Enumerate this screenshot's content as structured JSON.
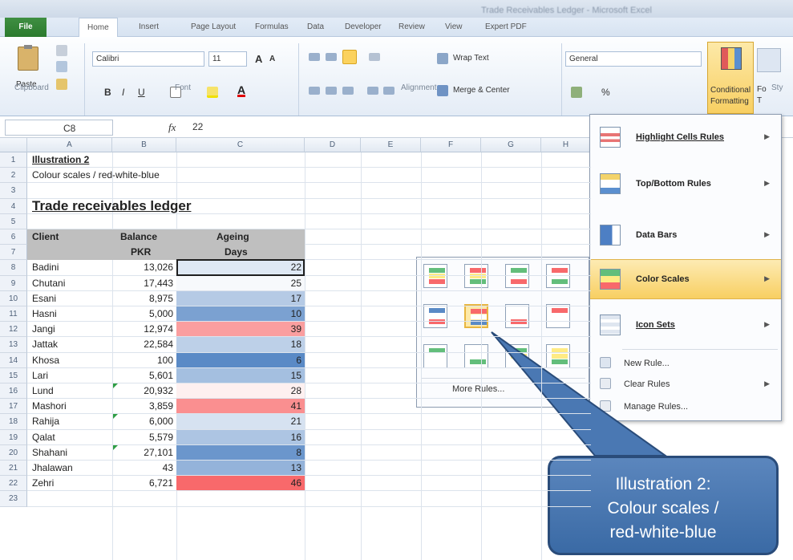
{
  "window": {
    "title": "Trade Receivables Ledger - Microsoft Excel"
  },
  "tabs": [
    "File",
    "Home",
    "Insert",
    "Page Layout",
    "Formulas",
    "Data",
    "Developer",
    "Review",
    "View",
    "Expert PDF"
  ],
  "ribbon": {
    "clipboard": {
      "paste": "Paste",
      "group": "Clipboard"
    },
    "font": {
      "name": "Calibri",
      "size": "11",
      "group": "Font",
      "bold": "B",
      "italic": "I",
      "underline": "U",
      "grow": "A",
      "shrink": "A"
    },
    "alignment": {
      "wrap": "Wrap Text",
      "merge": "Merge & Center",
      "group": "Alignment"
    },
    "number": {
      "format": "General",
      "percent": "%",
      "comma": ",",
      "inc": ".0",
      ".dec": ".00"
    },
    "styles": {
      "conditional": "Conditional",
      "formatting": "Formatting",
      "format_as": "Fo",
      "table": "T",
      "group": "Sty"
    }
  },
  "formula_bar": {
    "name_box": "C8",
    "fx": "fx",
    "value": "22"
  },
  "columns": [
    "A",
    "B",
    "C",
    "D",
    "E",
    "F",
    "G",
    "H"
  ],
  "sheet": {
    "a1": "Illustration 2",
    "a2": "Colour scales / red-white-blue",
    "a4": "Trade receivables ledger",
    "headers": {
      "client": "Client",
      "balance": "Balance",
      "pkr": "PKR",
      "ageing": "Ageing",
      "days": "Days"
    },
    "rows": [
      {
        "client": "Badini",
        "balance": "13,026",
        "days": "22"
      },
      {
        "client": "Chutani",
        "balance": "17,443",
        "days": "25"
      },
      {
        "client": "Esani",
        "balance": "8,975",
        "days": "17"
      },
      {
        "client": "Hasni",
        "balance": "5,000",
        "days": "10"
      },
      {
        "client": "Jangi",
        "balance": "12,974",
        "days": "39"
      },
      {
        "client": "Jattak",
        "balance": "22,584",
        "days": "18"
      },
      {
        "client": "Khosa",
        "balance": "100",
        "days": "6"
      },
      {
        "client": "Lari",
        "balance": "5,601",
        "days": "15"
      },
      {
        "client": "Lund",
        "balance": "20,932",
        "days": "28"
      },
      {
        "client": "Mashori",
        "balance": "3,859",
        "days": "41"
      },
      {
        "client": "Rahija",
        "balance": "6,000",
        "days": "21"
      },
      {
        "client": "Qalat",
        "balance": "5,579",
        "days": "16"
      },
      {
        "client": "Shahani",
        "balance": "27,101",
        "days": "8"
      },
      {
        "client": "Jhalawan",
        "balance": "43",
        "days": "13"
      },
      {
        "client": "Zehri",
        "balance": "6,721",
        "days": "46"
      }
    ],
    "row_numbers": [
      "1",
      "2",
      "3",
      "4",
      "5",
      "6",
      "7",
      "8",
      "9",
      "10",
      "11",
      "12",
      "13",
      "14",
      "15",
      "16",
      "17",
      "18",
      "19",
      "20",
      "21",
      "22",
      "23"
    ]
  },
  "cf_menu": {
    "highlight": "Highlight Cells Rules",
    "topbottom": "Top/Bottom Rules",
    "databars": "Data Bars",
    "colorscales": "Color Scales",
    "iconsets": "Icon Sets",
    "newrule": "New Rule...",
    "clearrules": "Clear Rules",
    "managerules": "Manage Rules..."
  },
  "color_scales_menu": {
    "more": "More Rules..."
  },
  "callout": {
    "line1": "Illustration 2:",
    "line2": "Colour scales /",
    "line3": "red-white-blue"
  },
  "colors": {
    "accent": "#2b7a2e",
    "highlight": "#fbe08a",
    "callout": "#4a78b3"
  }
}
